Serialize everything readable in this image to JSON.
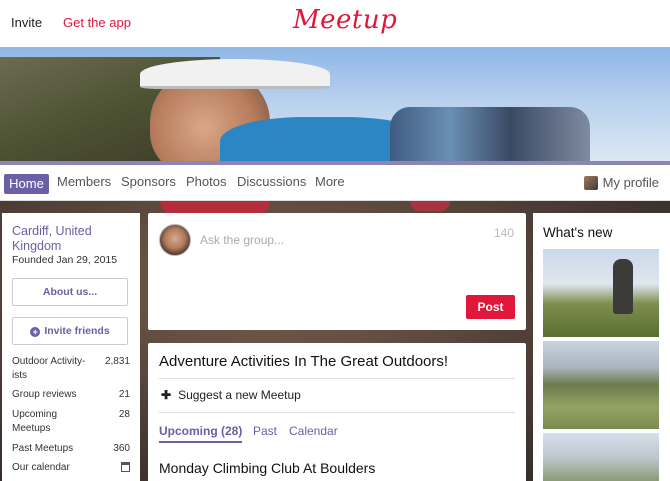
{
  "topbar": {
    "invite": "Invite",
    "get_app": "Get the app",
    "logo": "Meetup"
  },
  "nav": {
    "home": "Home",
    "members": "Members",
    "sponsors": "Sponsors",
    "photos": "Photos",
    "discussions": "Discussions",
    "more": "More",
    "my_profile": "My profile"
  },
  "sidebar": {
    "location": "Cardiff, United Kingdom",
    "founded": "Founded Jan 29, 2015",
    "about_button": "About us...",
    "invite_button": "Invite friends",
    "stats": [
      {
        "label": "Outdoor Activity-ists",
        "value": "2,831"
      },
      {
        "label": "Group reviews",
        "value": "21"
      },
      {
        "label": "Upcoming Meetups",
        "value": "28"
      },
      {
        "label": "Past Meetups",
        "value": "360"
      },
      {
        "label": "Our calendar",
        "value": ""
      }
    ]
  },
  "post": {
    "placeholder": "Ask the group...",
    "char_count": "140",
    "button": "Post"
  },
  "group": {
    "title": "Adventure Activities In The Great Outdoors!",
    "suggest": "Suggest a new Meetup",
    "tabs": [
      "Upcoming (28)",
      "Past",
      "Calendar"
    ],
    "first_event": "Monday Climbing Club At Boulders"
  },
  "right": {
    "whats_new": "What's new"
  },
  "colors": {
    "brand_red": "#e0173b",
    "accent_purple": "#6b5fa5"
  },
  "icons": [
    "plus-circle-icon",
    "plus-icon",
    "calendar-icon",
    "avatar"
  ]
}
